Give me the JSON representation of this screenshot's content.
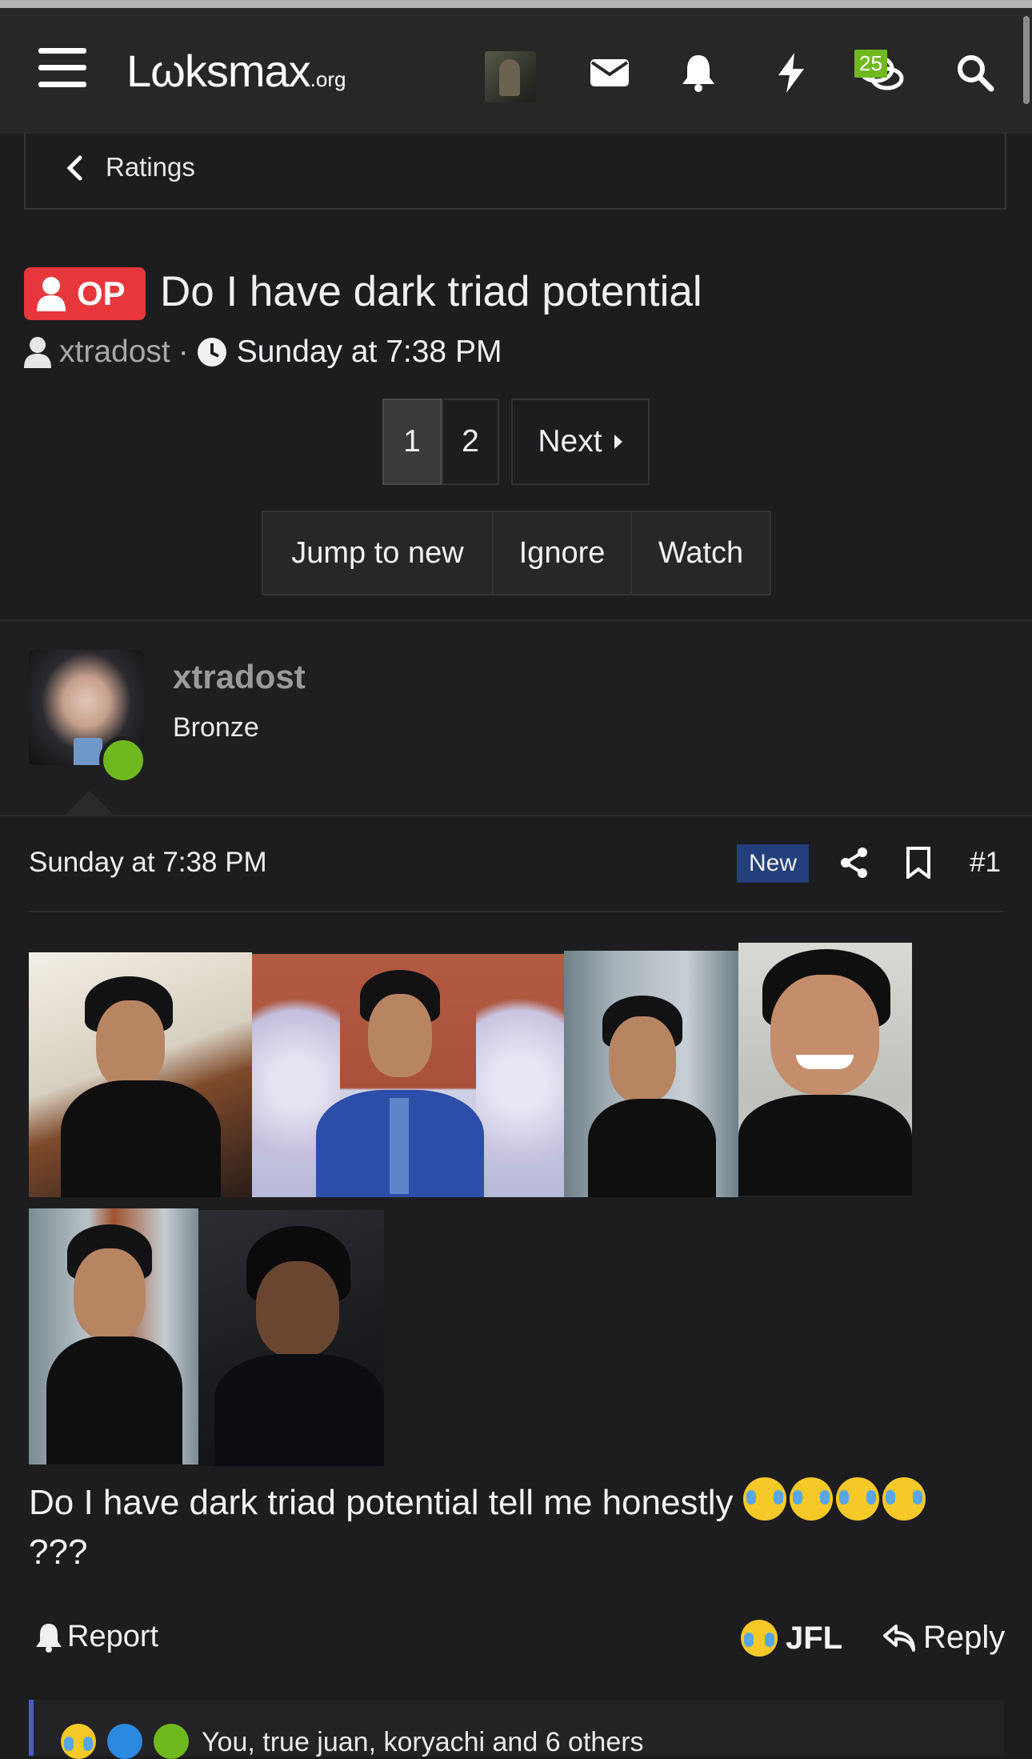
{
  "header": {
    "logo_text": "Lωksmax",
    "logo_suffix": ".org",
    "conversations_badge": "25",
    "icons": [
      "menu-icon",
      "avatar",
      "envelope-icon",
      "bell-icon",
      "bolt-icon",
      "chat-bubbles-icon",
      "search-icon"
    ]
  },
  "breadcrumb": {
    "label": "Ratings"
  },
  "thread": {
    "op_label": "OP",
    "title": "Do I have dark triad potential",
    "author": "xtradost",
    "separator": "·",
    "date": "Sunday at 7:38 PM"
  },
  "pagination": {
    "pages": [
      "1",
      "2"
    ],
    "current": "1",
    "next_label": "Next"
  },
  "actions": {
    "jump_label": "Jump to new",
    "ignore_label": "Ignore",
    "watch_label": "Watch"
  },
  "post": {
    "username": "xtradost",
    "rank": "Bronze",
    "date": "Sunday at 7:38 PM",
    "new_label": "New",
    "number": "#1",
    "body": "Do I have dark triad potential tell me honestly",
    "body_trailing": "???",
    "emoji_count": 4,
    "report_label": "Report",
    "jfl_label": "JFL",
    "reply_label": "Reply",
    "reactions_text": "You, true juan, koryachi and 6 others"
  },
  "colors": {
    "accent_op": "#e8373c",
    "online": "#6fb91f",
    "new_tag": "#233f7c",
    "background": "#1d1d1f"
  }
}
